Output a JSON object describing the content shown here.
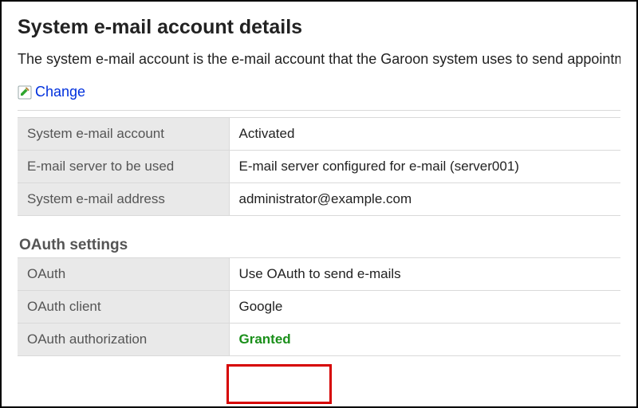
{
  "title": "System e-mail account details",
  "description": "The system e-mail account is the e-mail account that the Garoon system uses to send appointments.",
  "actions": {
    "change_label": "Change"
  },
  "account": {
    "rows": [
      {
        "label": "System e-mail account",
        "value": "Activated"
      },
      {
        "label": "E-mail server to be used",
        "value": "E-mail server configured for e-mail (server001)"
      },
      {
        "label": "System e-mail address",
        "value": "administrator@example.com"
      }
    ]
  },
  "oauth": {
    "heading": "OAuth settings",
    "rows": [
      {
        "label": "OAuth",
        "value": "Use OAuth to send e-mails"
      },
      {
        "label": "OAuth client",
        "value": "Google"
      },
      {
        "label": "OAuth authorization",
        "value": "Granted",
        "status": "granted"
      }
    ]
  }
}
